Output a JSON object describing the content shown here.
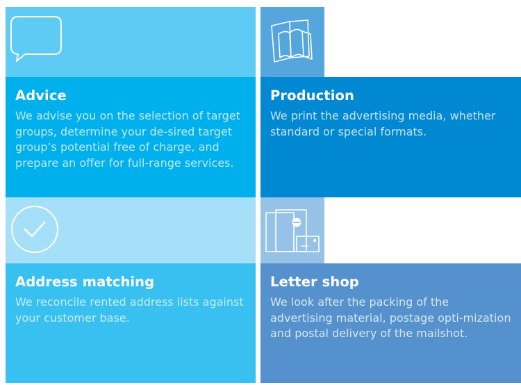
{
  "tiles": [
    {
      "title": "Advice",
      "text": "We advise you on the selection of target groups, determine your de-sired target group’s potential free of charge, and prepare an offer for full-range services.",
      "icon": "speech-bubble-icon"
    },
    {
      "title": "Production",
      "text": "We print the advertising media, whether standard or special formats.",
      "icon": "brochures-icon"
    },
    {
      "title": "Address matching",
      "text": "We reconcile rented address lists against your customer base.",
      "icon": "checkmark-circle-icon"
    },
    {
      "title": "Letter shop",
      "text": "We look after the packing of the advertising material, postage opti-mization and postal delivery of the mailshot.",
      "icon": "mail-envelopes-icon"
    }
  ],
  "colors": {
    "advice_body": "#00b0ec",
    "production_body": "#0088d2",
    "matching_body": "#38c0f1",
    "lettershop_body": "#5591cc"
  }
}
